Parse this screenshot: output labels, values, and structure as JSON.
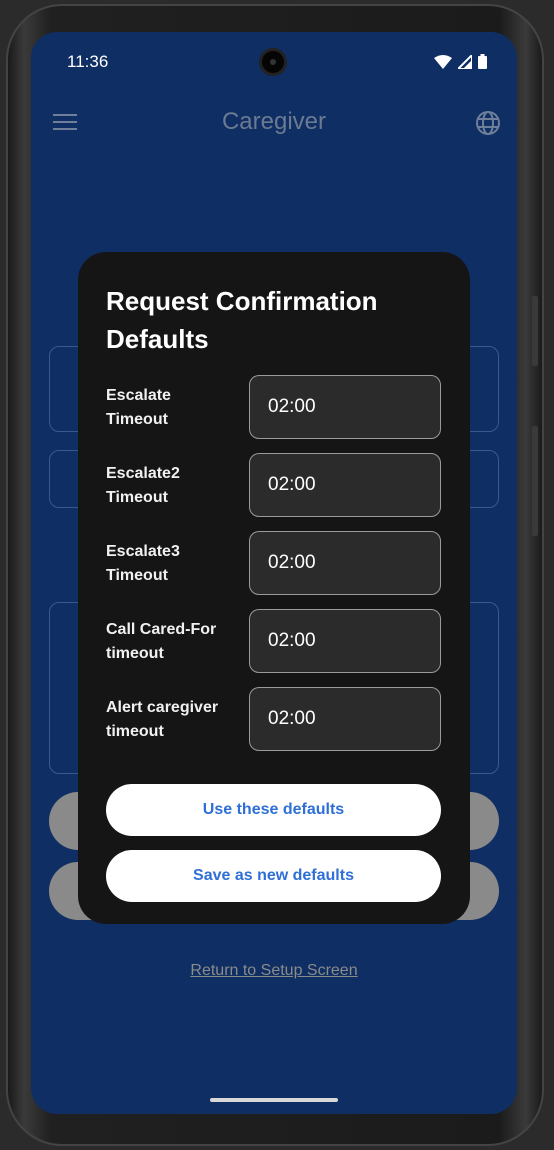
{
  "status_bar": {
    "time": "11:36"
  },
  "app_bar": {
    "title": "Caregiver"
  },
  "dialog": {
    "title": "Request Confirmation Defaults",
    "rows": [
      {
        "label": "Escalate Timeout",
        "value": "02:00"
      },
      {
        "label": "Escalate2 Timeout",
        "value": "02:00"
      },
      {
        "label": "Escalate3 Timeout",
        "value": "02:00"
      },
      {
        "label": "Call Cared-For timeout",
        "value": "02:00"
      },
      {
        "label": "Alert caregiver timeout",
        "value": "02:00"
      }
    ],
    "use_defaults_label": "Use these defaults",
    "save_defaults_label": "Save as new defaults"
  },
  "background": {
    "return_link": "Return to Setup Screen"
  },
  "colors": {
    "screen_bg": "#0f2e63",
    "dialog_bg": "#151515",
    "field_bg": "#2b2b2b",
    "button_text": "#2f6fd6"
  }
}
